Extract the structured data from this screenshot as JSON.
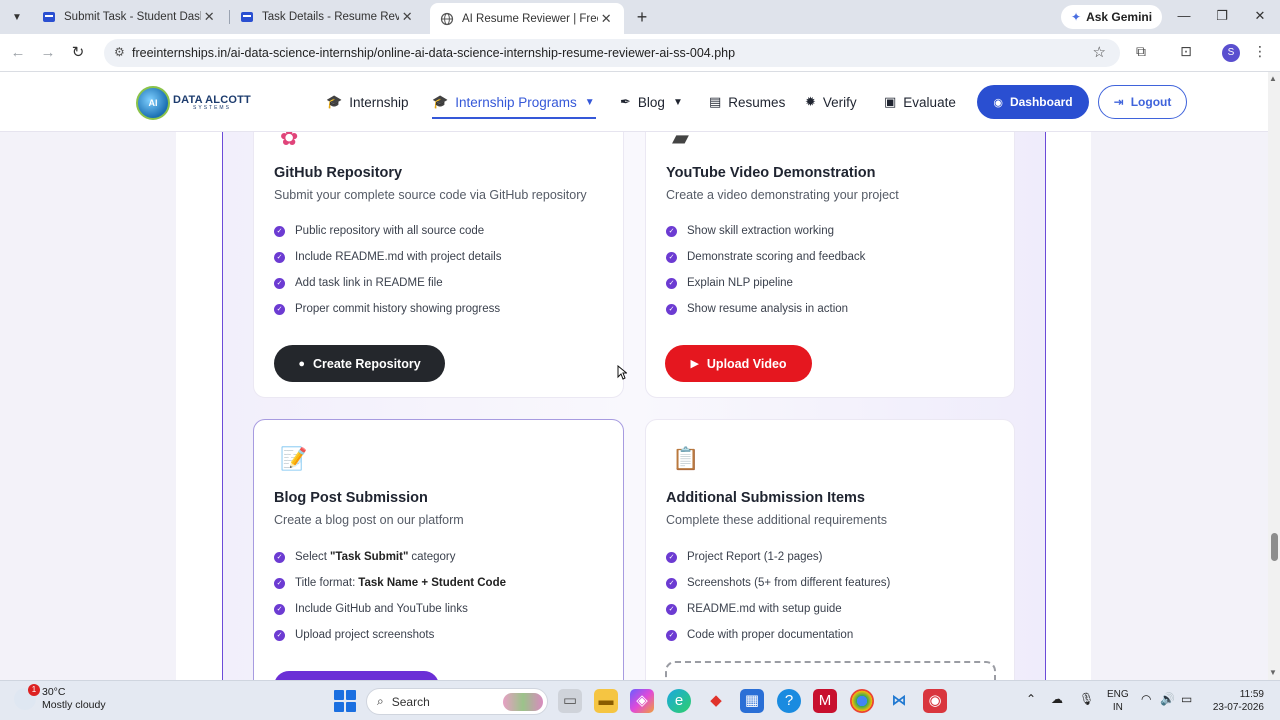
{
  "browser": {
    "tabs": [
      {
        "title": "Submit Task - Student Dashboard",
        "active": false
      },
      {
        "title": "Task Details - Resume Reviewer",
        "active": false
      },
      {
        "title": "AI Resume Reviewer | Free Online",
        "active": true
      }
    ],
    "ask_gemini": "Ask Gemini",
    "url": "freeinternships.in/ai-data-science-internship/online-ai-data-science-internship-resume-reviewer-ai-ss-004.php",
    "profile_initial": "S"
  },
  "site": {
    "logo_line1": "DATA ALCOTT",
    "logo_line2": "SYSTEMS",
    "nav": {
      "internship": "Internship",
      "internship_programs": "Internship Programs",
      "blog": "Blog",
      "resumes": "Resumes",
      "verify": "Verify",
      "evaluate": "Evaluate"
    },
    "dashboard_btn": "Dashboard",
    "logout_btn": "Logout"
  },
  "cards": {
    "github": {
      "title": "GitHub Repository",
      "desc": "Submit your complete source code via GitHub repository",
      "items": [
        "Public repository with all source code",
        "Include README.md with project details",
        "Add task link in README file",
        "Proper commit history showing progress"
      ],
      "button": "Create Repository"
    },
    "youtube": {
      "title": "YouTube Video Demonstration",
      "desc": "Create a video demonstrating your project",
      "items": [
        "Show skill extraction working",
        "Demonstrate scoring and feedback",
        "Explain NLP pipeline",
        "Show resume analysis in action"
      ],
      "button": "Upload Video"
    },
    "blog": {
      "title": "Blog Post Submission",
      "desc": "Create a blog post on our platform",
      "item1_pre": "Select",
      "item1_bold": "\"Task Submit\"",
      "item1_post": "category",
      "item2_pre": "Title format:",
      "item2_bold": "Task Name + Student Code",
      "item3": "Include GitHub and YouTube links",
      "item4": "Upload project screenshots"
    },
    "additional": {
      "title": "Additional Submission Items",
      "desc": "Complete these additional requirements",
      "items": [
        "Project Report (1-2 pages)",
        "Screenshots (5+ from different features)",
        "README.md with setup guide",
        "Code with proper documentation"
      ]
    }
  },
  "taskbar": {
    "weather_temp": "30°C",
    "weather_desc": "Mostly cloudy",
    "weather_badge": "1",
    "search_placeholder": "Search",
    "lang_line1": "ENG",
    "lang_line2": "IN",
    "time": "11:59",
    "date": "23-07-2026"
  },
  "colors": {
    "brand_blue": "#2a4fd1",
    "check_purple": "#6c3bd2",
    "youtube_red": "#e5171f",
    "github_dark": "#24272c"
  }
}
